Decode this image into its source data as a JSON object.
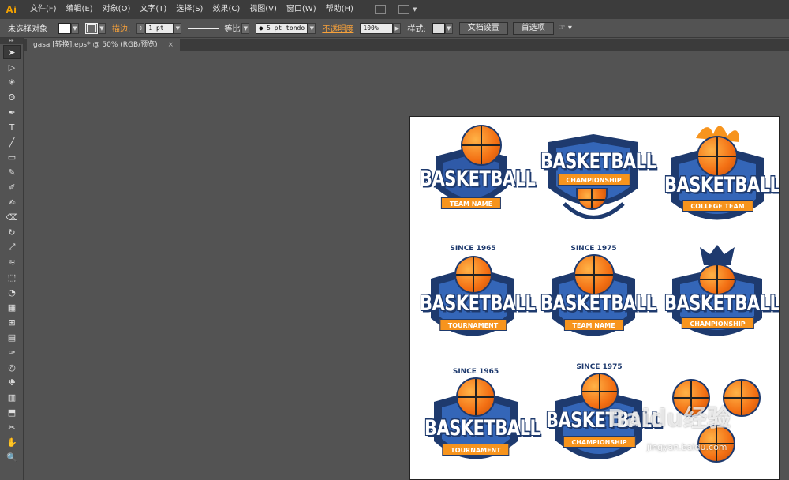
{
  "app": {
    "logo": "Ai"
  },
  "menu": {
    "items": [
      "文件(F)",
      "编辑(E)",
      "对象(O)",
      "文字(T)",
      "选择(S)",
      "效果(C)",
      "视图(V)",
      "窗口(W)",
      "帮助(H)"
    ]
  },
  "control": {
    "selection": "未选择对象",
    "stroke_label": "描边:",
    "stroke_weight": "1 pt",
    "stroke_profile": "等比",
    "brush": "5 pt tondo",
    "opacity_label": "不透明度",
    "opacity_value": "100%",
    "style_label": "样式:",
    "doc_setup": "文档设置",
    "preferences": "首选项"
  },
  "tab": {
    "title": "gasa [转换].eps* @ 50% (RGB/预览)",
    "close": "×"
  },
  "tools": [
    "selection-tool",
    "direct-selection-tool",
    "magic-wand-tool",
    "lasso-tool",
    "pen-tool",
    "type-tool",
    "line-tool",
    "rectangle-tool",
    "paintbrush-tool",
    "pencil-tool",
    "blob-brush-tool",
    "eraser-tool",
    "rotate-tool",
    "scale-tool",
    "width-tool",
    "free-transform-tool",
    "shape-builder-tool",
    "perspective-grid-tool",
    "mesh-tool",
    "gradient-tool",
    "eyedropper-tool",
    "blend-tool",
    "symbol-sprayer-tool",
    "column-graph-tool",
    "artboard-tool",
    "slice-tool",
    "hand-tool",
    "zoom-tool"
  ],
  "badges": [
    {
      "title": "BASKETBALL",
      "ribbon": "TEAM NAME",
      "arc": ""
    },
    {
      "title": "BASKETBALL",
      "ribbon": "CHAMPIONSHIP",
      "arc": ""
    },
    {
      "title": "BASKETBALL",
      "ribbon": "COLLEGE TEAM",
      "arc": ""
    },
    {
      "title": "BASKETBALL",
      "ribbon": "TOURNAMENT",
      "arc": "SINCE 1965"
    },
    {
      "title": "BASKETBALL",
      "ribbon": "TEAM NAME",
      "arc": "SINCE 1975"
    },
    {
      "title": "BASKETBALL",
      "ribbon": "CHAMPIONSHIP",
      "arc": ""
    },
    {
      "title": "BASKETBALL",
      "ribbon": "TOURNAMENT",
      "arc": "SINCE 1965"
    },
    {
      "title": "BASKETBALL",
      "ribbon": "CHAMPIONSHIP",
      "arc": "SINCE 1975"
    }
  ],
  "watermark": {
    "brand": "Baidu经验",
    "url": "jingyan.baidu.com"
  },
  "colors": {
    "navy": "#1e3a6e",
    "orange": "#f7941d",
    "ui_dark": "#3c3c3c",
    "ui_mid": "#535353"
  }
}
